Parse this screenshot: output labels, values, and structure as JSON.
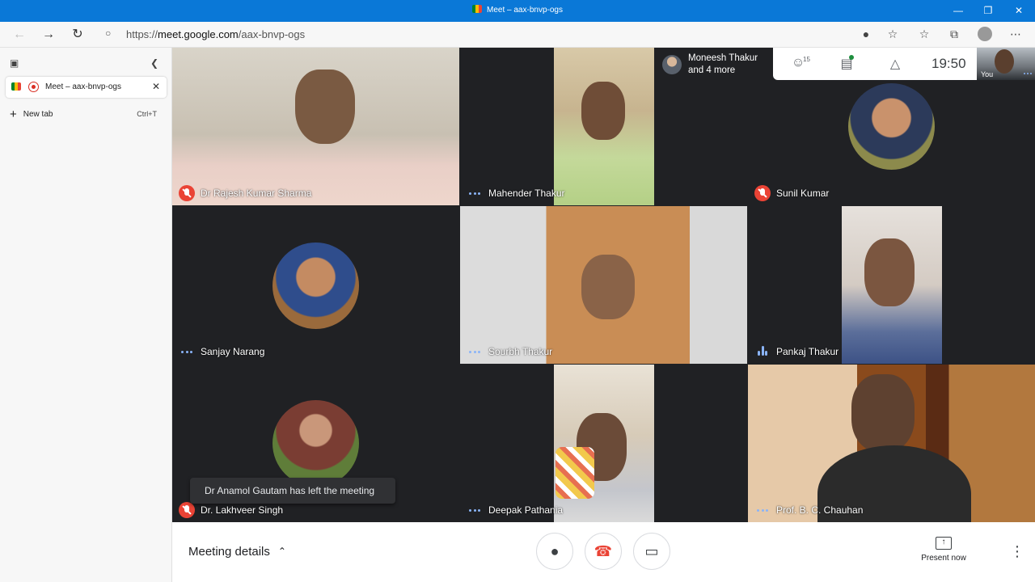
{
  "window": {
    "title": "Meet – aax-bnvp-ogs",
    "minimize": "—",
    "restore": "❐",
    "close": "✕"
  },
  "addressbar": {
    "url_prefix": "https://",
    "url_host": "meet.google.com",
    "url_path": "/aax-bnvp-ogs",
    "back_icon": "←",
    "forward_icon": "→",
    "refresh_icon": "↻",
    "lock_icon": "🔒",
    "mic_icon": "🎙",
    "fav_icon": "☆",
    "favorites_icon": "☆",
    "collections_icon": "⧉",
    "more_icon": "⋯"
  },
  "sidebar": {
    "tab_title": "Meet – aax-bnvp-ogs",
    "tab_close": "✕",
    "new_tab_label": "New tab",
    "new_tab_shortcut": "Ctrl+T"
  },
  "meet": {
    "pinned_name_line1": "Moneesh Thakur",
    "pinned_name_line2": "and 4 more",
    "people_count": "15",
    "clock": "19:50",
    "self_label": "You",
    "participants": [
      {
        "name": "Dr Rajesh Kumar Sharma",
        "status": "muted"
      },
      {
        "name": "Mahender Thakur",
        "status": "dots"
      },
      {
        "name": "Sunil Kumar",
        "status": "muted"
      },
      {
        "name": "Sanjay Narang",
        "status": "dots"
      },
      {
        "name": "Sourbh Thakur",
        "status": "dots"
      },
      {
        "name": "Pankaj Thakur",
        "status": "speaking"
      },
      {
        "name": "Dr. Lakhveer Singh",
        "status": "muted"
      },
      {
        "name": "Deepak Pathania",
        "status": "dots"
      },
      {
        "name": "Prof. B. C. Chauhan",
        "status": "dots"
      }
    ],
    "toast": "Dr Anamol Gautam has left the meeting"
  },
  "bottombar": {
    "meeting_details": "Meeting details",
    "chevron": "⌃",
    "present_now": "Present now",
    "mic_icon": "🎙",
    "end_icon": "☎",
    "camera_icon": "▭",
    "more_icon": "⋮"
  },
  "colors": {
    "titlebar": "#0a78d7",
    "meet_bg": "#202124",
    "mute_red": "#ea4335",
    "accent_blue": "#8ab4f8"
  }
}
